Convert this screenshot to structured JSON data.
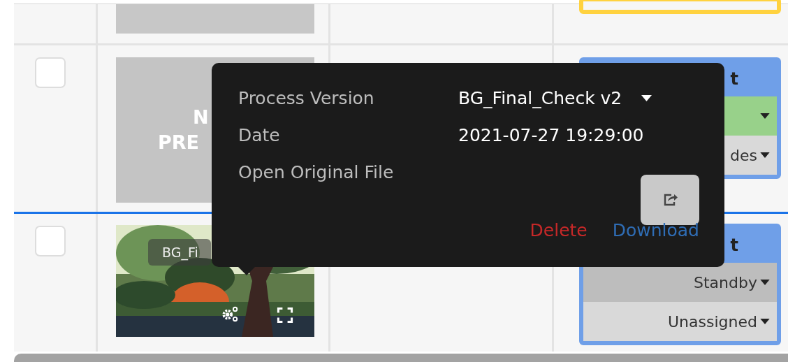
{
  "rows": [
    {
      "kind": "cut",
      "status_card": {
        "color": "#ffd23f"
      }
    },
    {
      "kind": "no_preview",
      "checked": false,
      "highlighted": false,
      "preview_text": [
        "N",
        "PRE"
      ],
      "status_card": {
        "color": "#6f9fe8",
        "header": "t",
        "selects": [
          {
            "color": "#98d18a"
          },
          {
            "color": "#d9d9d9",
            "value": "des"
          }
        ]
      }
    },
    {
      "checked": false,
      "highlighted": true,
      "thumbnail_label": "BG_Fi",
      "status_card": {
        "color": "#6f9fe8",
        "header": "t",
        "selects": [
          {
            "color": "#bdbdbd",
            "value": "Standby"
          },
          {
            "color": "#d9d9d9",
            "value": "Unassigned"
          }
        ]
      }
    }
  ],
  "popover": {
    "fields": [
      {
        "kind": "select",
        "label": "Process Version",
        "value": "BG_Final_Check v2"
      },
      {
        "kind": "text",
        "label": "Date",
        "value": "2021-07-27 19:29:00"
      },
      {
        "kind": "button",
        "label": "Open Original File"
      }
    ],
    "actions": [
      {
        "kind": "danger",
        "label": "Delete"
      },
      {
        "kind": "primary",
        "label": "Download"
      }
    ]
  }
}
